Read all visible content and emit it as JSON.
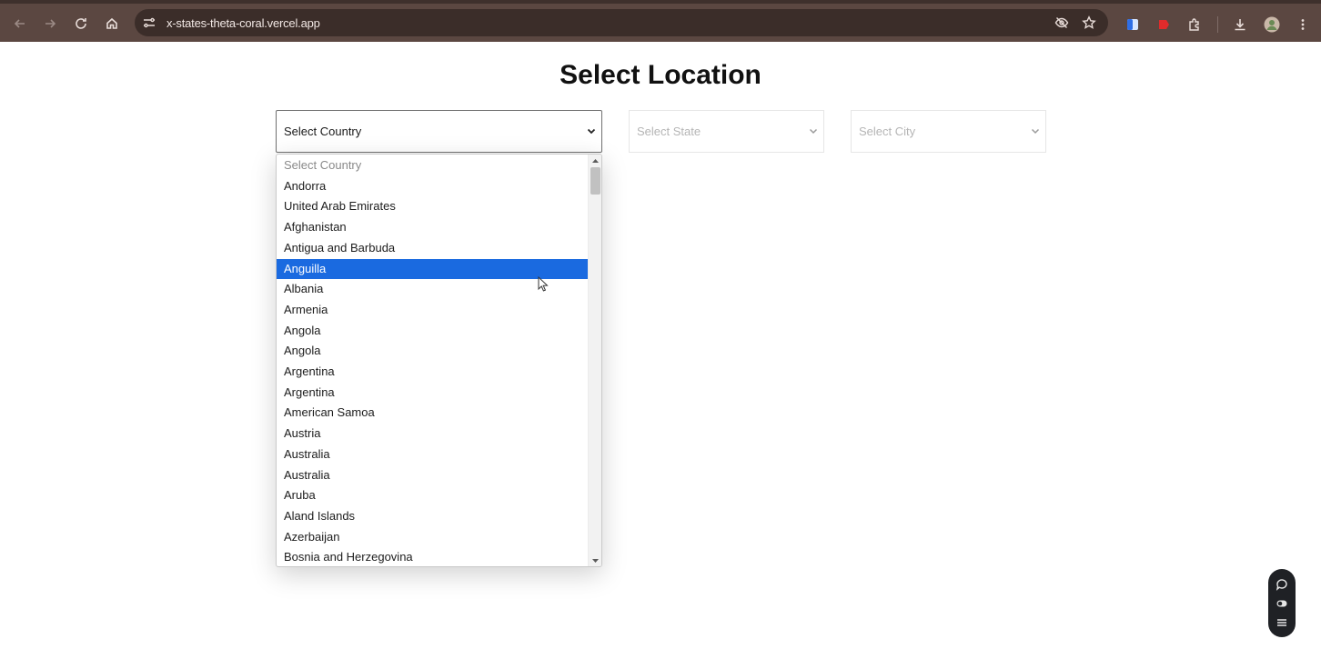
{
  "browser": {
    "url": "x-states-theta-coral.vercel.app"
  },
  "page": {
    "title": "Select Location"
  },
  "selects": {
    "country": "Select Country",
    "state": "Select State",
    "city": "Select City"
  },
  "country_dropdown": {
    "options": [
      "Select Country",
      "Andorra",
      "United Arab Emirates",
      "Afghanistan",
      "Antigua and Barbuda",
      "Anguilla",
      "Albania",
      "Armenia",
      "Angola",
      "Angola",
      "Argentina",
      "Argentina",
      "American Samoa",
      "Austria",
      "Australia",
      "Australia",
      "Aruba",
      "Aland Islands",
      "Azerbaijan",
      "Bosnia and Herzegovina"
    ],
    "highlighted": "Anguilla"
  },
  "colors": {
    "chrome": "#5b4741",
    "highlight": "#1a6ae0"
  }
}
